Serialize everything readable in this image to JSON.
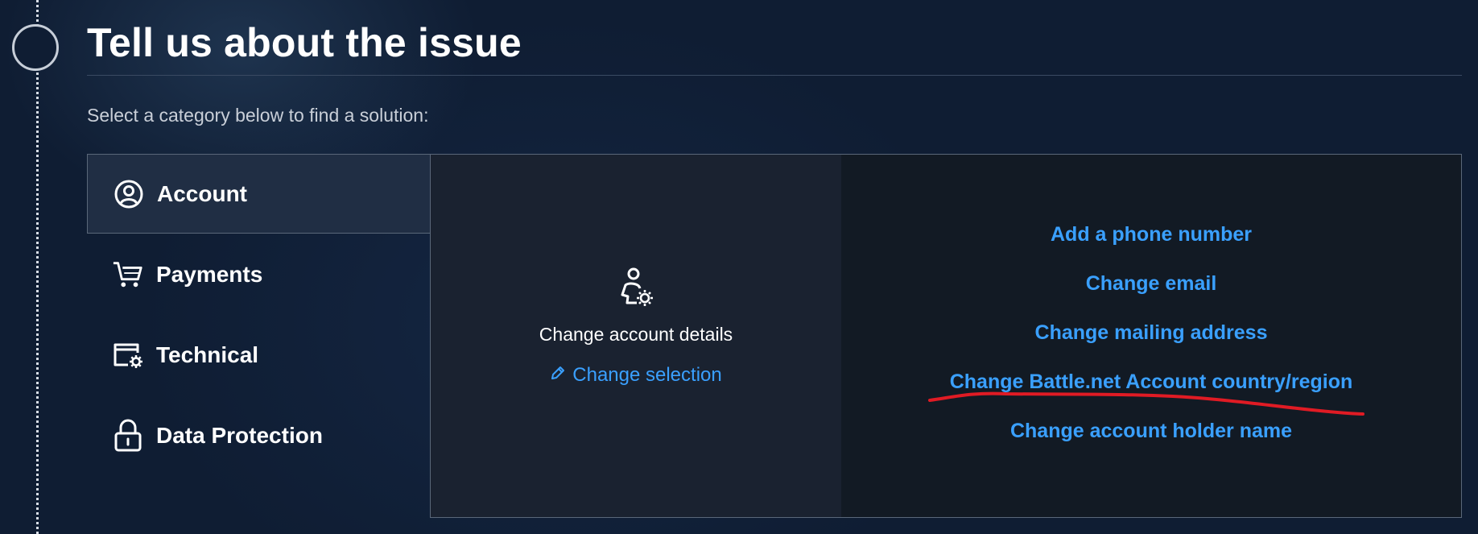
{
  "page": {
    "title": "Tell us about the issue",
    "subtitle": "Select a category below to find a solution:"
  },
  "categories": [
    {
      "label": "Account",
      "icon": "account-circle-icon",
      "active": true
    },
    {
      "label": "Payments",
      "icon": "cart-icon",
      "active": false
    },
    {
      "label": "Technical",
      "icon": "window-gear-icon",
      "active": false
    },
    {
      "label": "Data Protection",
      "icon": "lock-icon",
      "active": false
    }
  ],
  "selection": {
    "icon": "user-gear-icon",
    "label": "Change account details",
    "change_label": "Change selection",
    "change_icon": "pencil-icon"
  },
  "options": [
    "Add a phone number",
    "Change email",
    "Change mailing address",
    "Change Battle.net Account country/region",
    "Change account holder name"
  ],
  "colors": {
    "background": "#0f1d33",
    "link": "#3aa0ff",
    "annotation": "#e01b24"
  }
}
